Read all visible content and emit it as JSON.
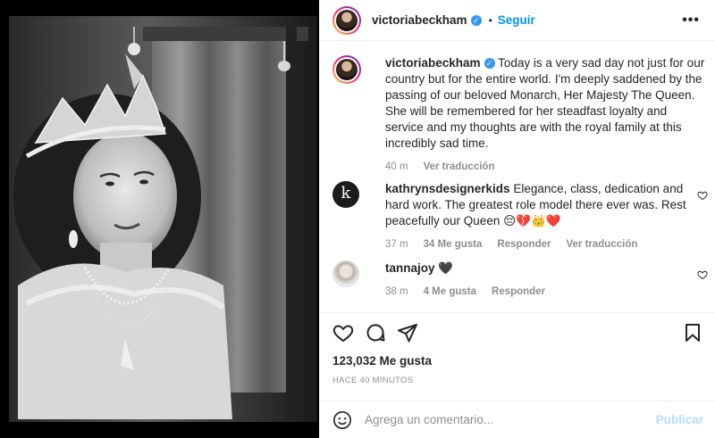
{
  "post": {
    "author": "victoriabeckham",
    "follow_label": "Seguir",
    "more_label": "•••",
    "caption": "Today is a very sad day not just for our country but for the entire world. I'm deeply saddened by the passing of our beloved Monarch, Her Majesty The Queen. She will be remembered for her steadfast loyalty and service and my thoughts are with the royal family at this incredibly sad time.",
    "caption_time": "40 m",
    "caption_translate": "Ver traducción"
  },
  "comments": [
    {
      "user": "kathrynsdesignerkids",
      "avatar_letter": "k",
      "text": "Elegance, class, dedication and hard work. The greatest role model there ever was. Rest peacefully our Queen 😔💔👑❤️",
      "time": "37 m",
      "likes": "34 Me gusta",
      "reply": "Responder",
      "translate": "Ver traducción"
    },
    {
      "user": "tannajoy",
      "text": "🖤",
      "time": "38 m",
      "likes": "4 Me gusta",
      "reply": "Responder"
    }
  ],
  "stats": {
    "likes": "123,032 Me gusta",
    "posted": "HACE 40 MINUTOS"
  },
  "composer": {
    "placeholder": "Agrega un comentario...",
    "publish": "Publicar"
  },
  "colors": {
    "accent": "#0095f6",
    "verified": "#3897f0",
    "muted": "#8e8e8e",
    "publish_disabled": "#b3dbff"
  }
}
